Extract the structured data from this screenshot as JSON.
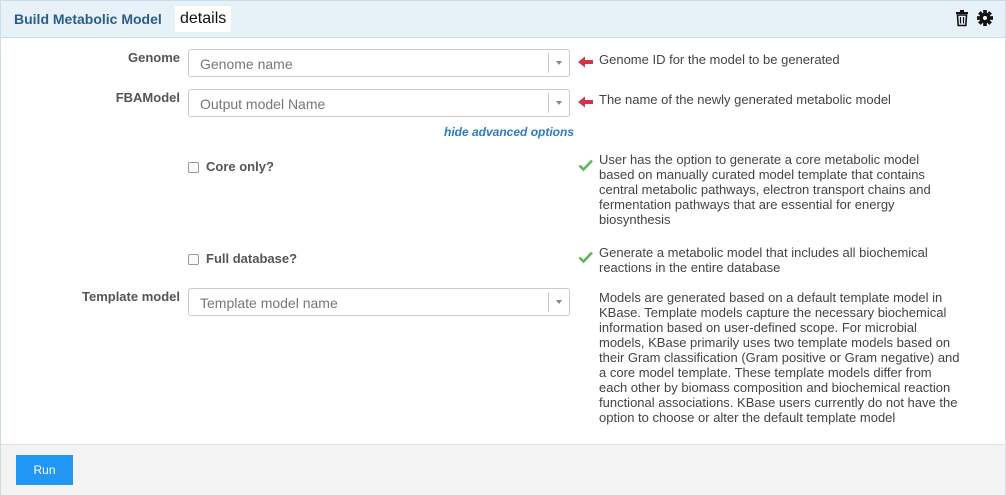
{
  "header": {
    "title": "Build Metabolic Model",
    "details_label": "details",
    "icons": [
      "trash-icon",
      "gear-icon"
    ]
  },
  "fields": {
    "genome": {
      "label": "Genome",
      "placeholder": "Genome name",
      "hint": "Genome ID for the model to be generated",
      "status_icon": "arrow-left-icon"
    },
    "fbamodel": {
      "label": "FBAModel",
      "placeholder": "Output model Name",
      "hint": "The name of the newly generated metabolic model",
      "status_icon": "arrow-left-icon"
    },
    "advanced_toggle": "hide advanced options",
    "core_only": {
      "label": "Core only?",
      "checked": false,
      "hint_lines": [
        "User has the option to generate a core metabolic model",
        "based on manually curated model template that contains",
        "central metabolic pathways, electron transport chains and",
        "fermentation pathways that are essential for energy",
        "biosynthesis"
      ],
      "status_icon": "checkmark-icon"
    },
    "full_database": {
      "label": "Full database?",
      "checked": false,
      "hint_lines": [
        "Generate a metabolic model that includes all biochemical",
        "reactions in the entire database"
      ],
      "status_icon": "checkmark-icon"
    },
    "template_model": {
      "label": "Template model",
      "placeholder": "Template model name",
      "hint_lines": [
        "Models are generated based on a default template model in",
        "KBase. Template models capture the necessary biochemical",
        "information based on user-defined scope. For microbial",
        "models, KBase primarily uses two template models based on",
        "their Gram classification (Gram positive or Gram negative) and",
        "a core model template. These template models differ from",
        "each other by biomass composition and biochemical reaction",
        "functional associations. KBase users currently do not have the",
        "option to choose or alter the default template model"
      ]
    }
  },
  "footer": {
    "run_label": "Run"
  },
  "colors": {
    "header_bg": "#e6f1f8",
    "title": "#2b5d8c",
    "arrow": "#d0344a",
    "check": "#5cb85c",
    "run_button": "#2196f3",
    "link": "#2a7ac7"
  }
}
